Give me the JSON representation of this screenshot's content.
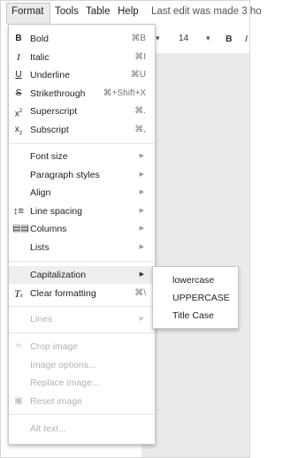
{
  "menubar": {
    "items": [
      "Format",
      "Tools",
      "Table",
      "Help"
    ],
    "last_edit": "Last edit was made 3 ho"
  },
  "toolbar": {
    "font_size": "14",
    "bold_label": "B",
    "italic_label": "I"
  },
  "format_menu": {
    "bold": {
      "label": "Bold",
      "shortcut": "⌘B"
    },
    "italic": {
      "label": "Italic",
      "shortcut": "⌘I"
    },
    "underline": {
      "label": "Underline",
      "shortcut": "⌘U"
    },
    "strikethrough": {
      "label": "Strikethrough",
      "shortcut": "⌘+Shift+X"
    },
    "superscript": {
      "label": "Superscript",
      "shortcut": "⌘."
    },
    "subscript": {
      "label": "Subscript",
      "shortcut": "⌘,"
    },
    "font_size": {
      "label": "Font size"
    },
    "paragraph_styles": {
      "label": "Paragraph styles"
    },
    "align": {
      "label": "Align"
    },
    "line_spacing": {
      "label": "Line spacing"
    },
    "columns": {
      "label": "Columns"
    },
    "lists": {
      "label": "Lists"
    },
    "capitalization": {
      "label": "Capitalization"
    },
    "clear_formatting": {
      "label": "Clear formatting",
      "shortcut": "⌘\\"
    },
    "lines": {
      "label": "Lines"
    },
    "crop_image": {
      "label": "Crop image"
    },
    "image_options": {
      "label": "Image options..."
    },
    "replace_image": {
      "label": "Replace image..."
    },
    "reset_image": {
      "label": "Reset image"
    },
    "alt_text": {
      "label": "Alt text..."
    }
  },
  "capitalization_submenu": {
    "items": [
      "lowercase",
      "UPPERCASE",
      "Title Case"
    ]
  }
}
